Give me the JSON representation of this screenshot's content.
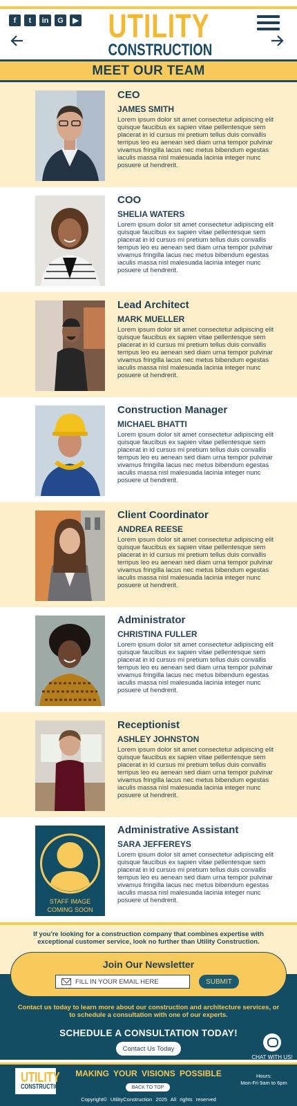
{
  "header": {
    "social": [
      {
        "icon": "facebook-icon",
        "glyph": "f"
      },
      {
        "icon": "twitter-icon",
        "glyph": "t"
      },
      {
        "icon": "linkedin-icon",
        "glyph": "in"
      },
      {
        "icon": "google-icon",
        "glyph": "G"
      },
      {
        "icon": "youtube-icon",
        "glyph": "▶"
      }
    ],
    "logo_line1": "UTILITY",
    "logo_line2": "CONSTRUCTION"
  },
  "page_title": "MEET OUR TEAM",
  "team": [
    {
      "role": "CEO",
      "name": "JAMES SMITH",
      "bio": "Lorem ipsum dolor sit amet consectetur adipiscing elit quisque faucibus ex sapien vitae pellentesque sem placerat in id cursus mi pretium tellus duis convallis tempus leo eu aenean sed diam urna tempor pulvinar vivamus fringilla lacus nec metus bibendum egestas iaculis massa nisl malesuada lacinia integer nunc posuere ut hendrerit."
    },
    {
      "role": "COO",
      "name": "SHELIA WATERS",
      "bio": "Lorem ipsum dolor sit amet consectetur adipiscing elit quisque faucibus ex sapien vitae pellentesque sem placerat in id cursus mi pretium tellus duis convallis tempus leo eu aenean sed diam urna tempor pulvinar vivamus fringilla lacus nec metus bibendum egestas iaculis massa nisl malesuada lacinia integer nunc posuere ut hendrerit."
    },
    {
      "role": "Lead Architect",
      "name": "MARK MUELLER",
      "bio": "Lorem ipsum dolor sit amet consectetur adipiscing elit quisque faucibus ex sapien vitae pellentesque sem placerat in id cursus mi pretium tellus duis convallis tempus leo eu aenean sed diam urna tempor pulvinar vivamus fringilla lacus nec metus bibendum egestas iaculis massa nisl malesuada lacinia integer nunc posuere ut hendrerit."
    },
    {
      "role": "Construction Manager",
      "name": "MICHAEL BHATTI",
      "bio": "Lorem ipsum dolor sit amet consectetur adipiscing elit quisque faucibus ex sapien vitae pellentesque sem placerat in id cursus mi pretium tellus duis convallis tempus leo eu aenean sed diam urna tempor pulvinar vivamus fringilla lacus nec metus bibendum egestas iaculis massa nisl malesuada lacinia integer nunc posuere ut hendrerit."
    },
    {
      "role": "Client Coordinator",
      "name": "ANDREA REESE",
      "bio": "Lorem ipsum dolor sit amet consectetur adipiscing elit quisque faucibus ex sapien vitae pellentesque sem placerat in id cursus mi pretium tellus duis convallis tempus leo eu aenean sed diam urna tempor pulvinar vivamus fringilla lacus nec metus bibendum egestas iaculis massa nisl malesuada lacinia integer nunc posuere ut hendrerit."
    },
    {
      "role": "Administrator",
      "name": "CHRISTINA FULLER",
      "bio": "Lorem ipsum dolor sit amet consectetur adipiscing elit quisque faucibus ex sapien vitae pellentesque sem placerat in id cursus mi pretium tellus duis convallis tempus leo eu aenean sed diam urna tempor pulvinar vivamus fringilla lacus nec metus bibendum egestas iaculis massa nisl malesuada lacinia integer nunc posuere ut hendrerit."
    },
    {
      "role": "Receptionist",
      "name": "ASHLEY JOHNSTON",
      "bio": "Lorem ipsum dolor sit amet consectetur adipiscing elit quisque faucibus ex sapien vitae pellentesque sem placerat in id cursus mi pretium tellus duis convallis tempus leo eu aenean sed diam urna tempor pulvinar vivamus fringilla lacus nec metus bibendum egestas iaculis massa nisl malesuada lacinia integer nunc posuere ut hendrerit."
    },
    {
      "role": "Administrative Assistant",
      "name": "SARA JEFFEREYS",
      "bio": "Lorem ipsum dolor sit amet consectetur adipiscing elit quisque faucibus ex sapien vitae pellentesque sem placerat in id cursus mi pretium tellus duis convallis tempus leo eu aenean sed diam urna tempor pulvinar vivamus fringilla lacus nec metus bibendum egestas iaculis massa nisl malesuada lacinia integer nunc posuere ut hendrerit.",
      "placeholder_text": "STAFF IMAGE COMING SOON"
    }
  ],
  "footer": {
    "promo": "If you're looking for a construction company that combines expertise with exceptional customer service, look no further than Utility Construction.",
    "newsletter_title": "Join Our Newsletter",
    "email_placeholder": "FILL IN YOUR EMAIL HERE",
    "submit_label": "SUBMIT",
    "contact_text": "Contact us today to learn more about our construction and architecture services, or to schedule a consultation with one of our experts.",
    "cta_heading": "SCHEDULE A CONSULTATION TODAY!",
    "contact_button": "Contact Us Today",
    "chat_label": "CHAT WITH US!",
    "tagline": "MAKING YOUR VISIONS POSSIBLE",
    "back_to_top": "BACK TO TOP",
    "copyright": "Copyright©  UtilityConstruction 2025  All rights reserved",
    "hours_label": "Hours:",
    "hours_value": "Mon-Fri 9am to 6pm",
    "logo_line1": "UTILITY",
    "logo_line2": "CONSTRUCTION"
  },
  "colors": {
    "accent": "#f9c94f",
    "dark": "#134d64",
    "cream": "#fdefca"
  }
}
